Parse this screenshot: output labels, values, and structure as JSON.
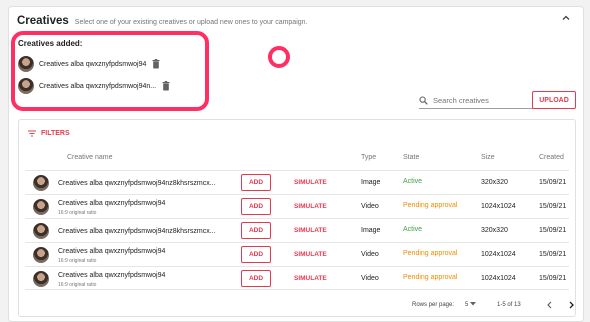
{
  "header": {
    "title": "Creatives",
    "subtitle": "Select one of your existing creatives or upload new ones to your campaign."
  },
  "added": {
    "title": "Creatives added:",
    "items": [
      {
        "name": "Creatives alba qwxznyfpdsmwoj94"
      },
      {
        "name": "Creatives alba qwxznyfpdsmwoj94n..."
      }
    ]
  },
  "search": {
    "placeholder": "Search creatives"
  },
  "upload_label": "UPLOAD",
  "filters_label": "FILTERS",
  "table": {
    "headers": {
      "name": "Creative name",
      "type": "Type",
      "state": "State",
      "size": "Size",
      "created": "Created"
    },
    "add_label": "ADD",
    "simulate_label": "SIMULATE",
    "rows": [
      {
        "name": "Creatives alba qwxznyfpdsmwoj94nz8khsrszmcx...",
        "sub": "",
        "type": "Image",
        "state": "Active",
        "size": "320x320",
        "created": "15/09/21"
      },
      {
        "name": "Creatives alba qwxznyfpdsmwoj94",
        "sub": "16:9 original ratio",
        "type": "Video",
        "state": "Pending approval",
        "size": "1024x1024",
        "created": "15/09/21"
      },
      {
        "name": "Creatives alba qwxznyfpdsmwoj94nz8khsrszmcx...",
        "sub": "",
        "type": "Image",
        "state": "Active",
        "size": "320x320",
        "created": "15/09/21"
      },
      {
        "name": "Creatives alba qwxznyfpdsmwoj94",
        "sub": "16:9 original ratio",
        "type": "Video",
        "state": "Pending approval",
        "size": "1024x1024",
        "created": "15/09/21"
      },
      {
        "name": "Creatives alba qwxznyfpdsmwoj94",
        "sub": "16:9 original ratio",
        "type": "Video",
        "state": "Pending approval",
        "size": "1024x1024",
        "created": "15/09/21"
      }
    ]
  },
  "pagination": {
    "rows_per_page_label": "Rows per page:",
    "rows_per_page": "5",
    "range": "1-5 of 13"
  },
  "colors": {
    "accent": "#e53950",
    "active": "#43a047",
    "pending": "#f08c00",
    "highlight": "#ff2e63"
  },
  "icons": [
    "chevron-up-icon",
    "trash-icon",
    "search-icon",
    "filter-icon",
    "chevron-left-icon",
    "chevron-right-icon",
    "caret-down-icon"
  ]
}
